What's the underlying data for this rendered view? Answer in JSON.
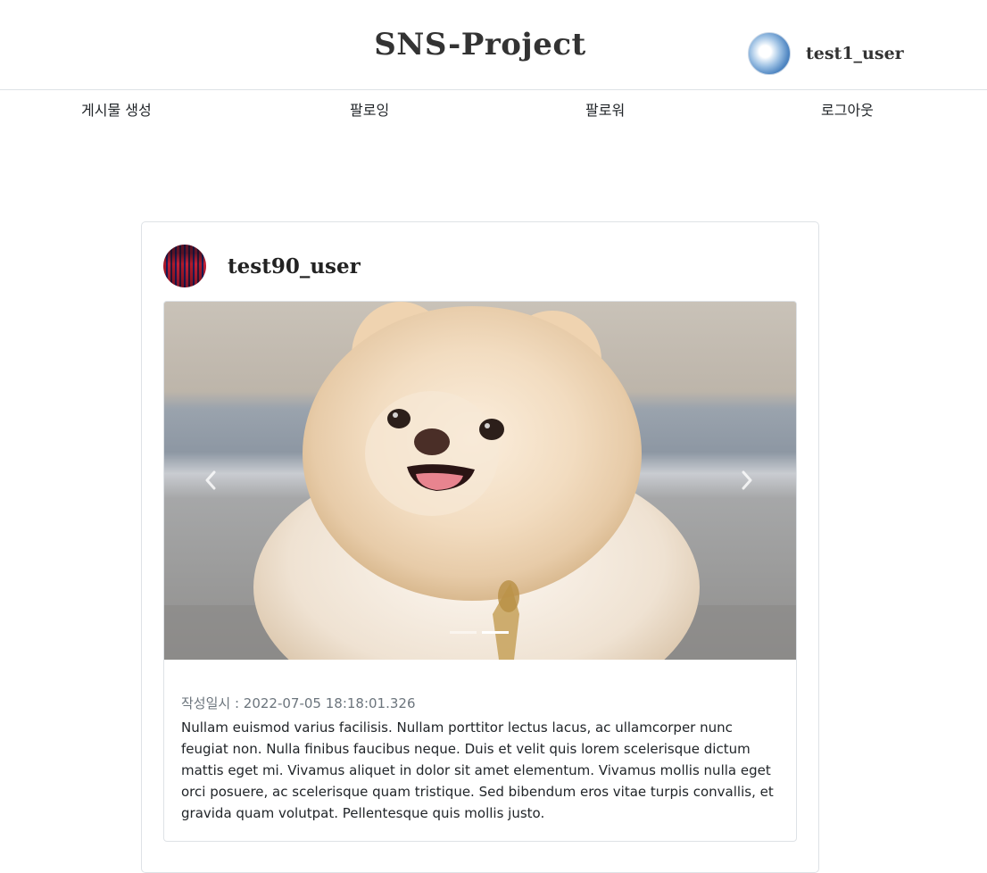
{
  "header": {
    "title": "SNS-Project",
    "username": "test1_user",
    "avatar_icon": "sky-avatar"
  },
  "nav": {
    "items": [
      {
        "label": "게시물 생성"
      },
      {
        "label": "팔로잉"
      },
      {
        "label": "팔로워"
      },
      {
        "label": "로그아웃"
      }
    ]
  },
  "post": {
    "author": "test90_user",
    "author_avatar_icon": "crowd-avatar",
    "image_icon": "pomeranian-photo",
    "carousel": {
      "slide_count": 2,
      "active_index": 1,
      "prev_icon": "chevron-left-icon",
      "next_icon": "chevron-right-icon"
    },
    "date_text": "작성일시 : 2022-07-05 18:18:01.326",
    "content": "Nullam euismod varius facilisis. Nullam porttitor lectus lacus, ac ullamcorper nunc feugiat non. Nulla finibus faucibus neque. Duis et velit quis lorem scelerisque dictum mattis eget mi. Vivamus aliquet in dolor sit amet elementum. Vivamus mollis nulla eget orci posuere, ac scelerisque quam tristique. Sed bibendum eros vitae turpis convallis, et gravida quam volutpat. Pellentesque quis mollis justo."
  }
}
